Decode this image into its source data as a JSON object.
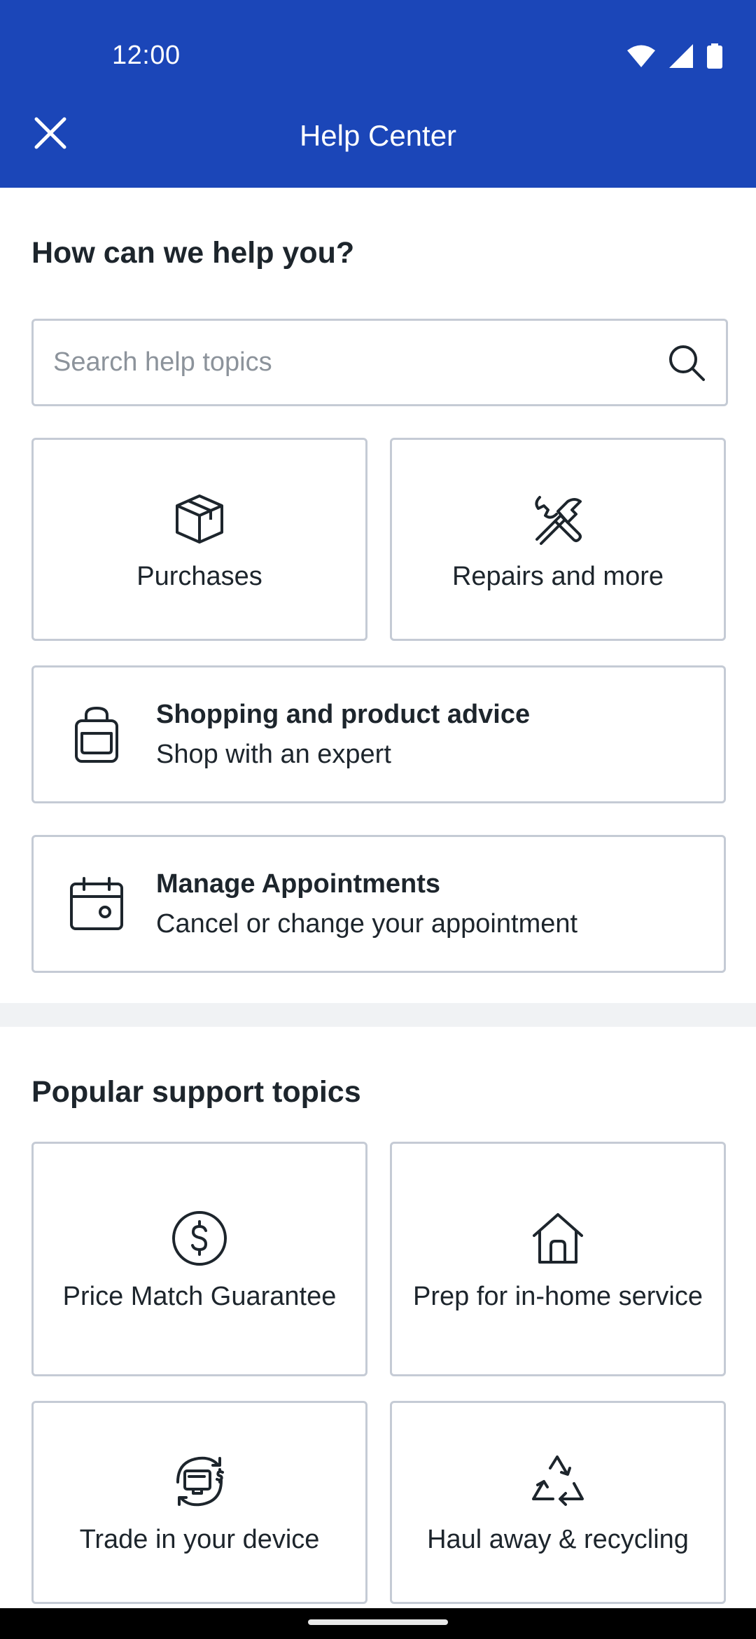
{
  "status_bar": {
    "time": "12:00"
  },
  "header": {
    "title": "Help Center"
  },
  "help": {
    "heading": "How can we help you?",
    "search_placeholder": "Search help topics",
    "tiles": [
      {
        "label": "Purchases",
        "icon": "box-icon"
      },
      {
        "label": "Repairs and more",
        "icon": "tools-icon"
      }
    ],
    "rows": [
      {
        "title": "Shopping and product advice",
        "subtitle": "Shop with an expert",
        "icon": "shopping-bag-icon"
      },
      {
        "title": "Manage Appointments",
        "subtitle": "Cancel or change your appointment",
        "icon": "calendar-icon"
      }
    ]
  },
  "popular": {
    "heading": "Popular support topics",
    "tiles": [
      {
        "label": "Price Match Guarantee",
        "icon": "dollar-icon"
      },
      {
        "label": "Prep for in-home service",
        "icon": "home-icon"
      },
      {
        "label": "Trade in your device",
        "icon": "trade-in-icon"
      },
      {
        "label": "Haul away & recycling",
        "icon": "recycle-icon"
      }
    ]
  },
  "colors": {
    "header_bg": "#1b46b8",
    "text": "#1d252c",
    "border": "#c5cbd5"
  }
}
